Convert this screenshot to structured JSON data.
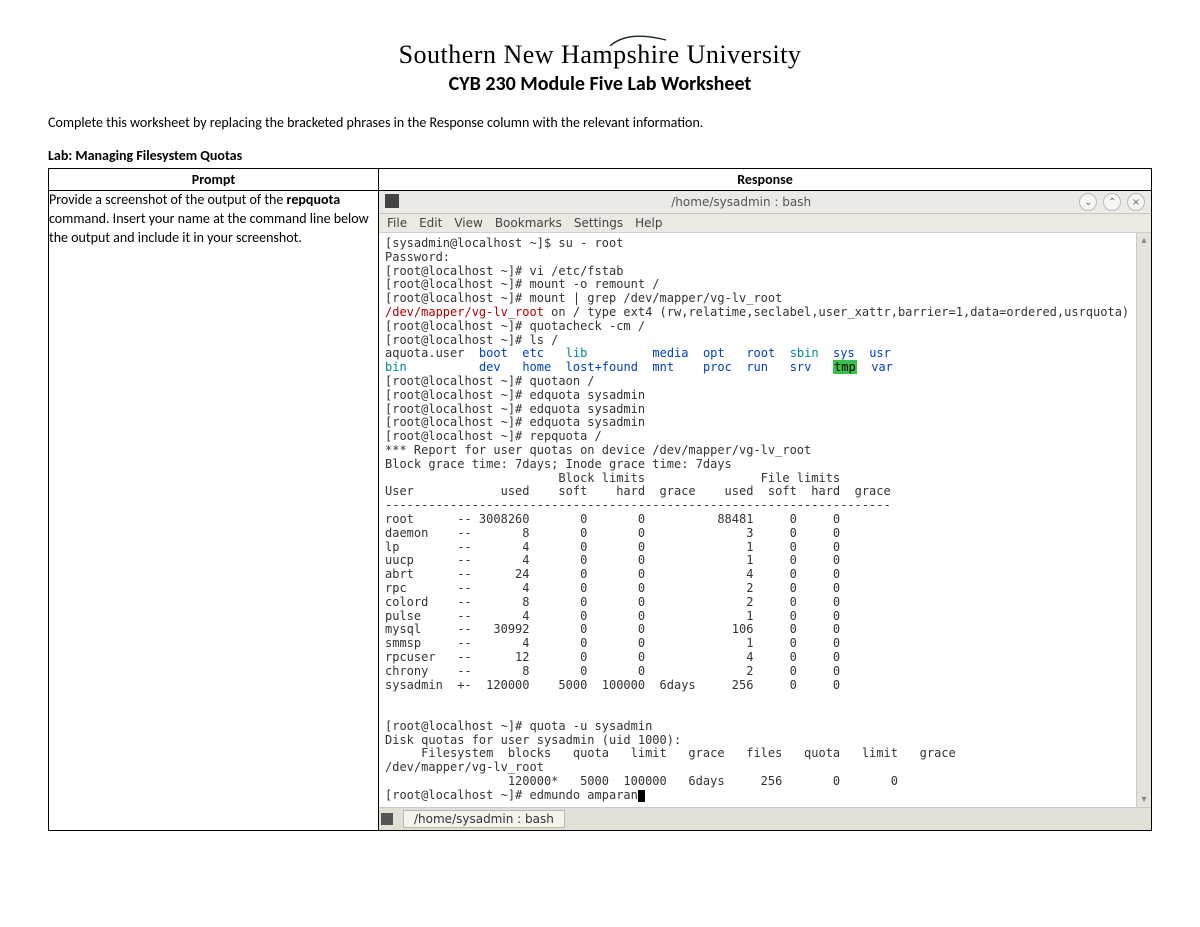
{
  "header": {
    "university": "Southern New Hampshire University",
    "course_title": "CYB 230 Module Five Lab Worksheet"
  },
  "instruction": "Complete this worksheet by replacing the bracketed phrases in the Response column with the relevant information.",
  "lab_section": "Lab: Managing Filesystem Quotas",
  "table": {
    "headers": {
      "prompt": "Prompt",
      "response": "Response"
    },
    "prompt_html": "Provide a screenshot of the output of the <b>repquota</b> command. Insert your name at the command line below the output and include it in your screenshot."
  },
  "window": {
    "title": "/home/sysadmin : bash",
    "menu": [
      "File",
      "Edit",
      "View",
      "Bookmarks",
      "Settings",
      "Help"
    ],
    "taskbar_tab": "/home/sysadmin : bash"
  },
  "terminal": {
    "lines": [
      {
        "segs": [
          {
            "t": "[sysadmin@localhost ~]$ su - root"
          }
        ]
      },
      {
        "segs": [
          {
            "t": "Password:"
          }
        ]
      },
      {
        "segs": [
          {
            "t": "[root@localhost ~]# vi /etc/fstab"
          }
        ]
      },
      {
        "segs": [
          {
            "t": "[root@localhost ~]# mount -o remount /"
          }
        ]
      },
      {
        "segs": [
          {
            "t": "[root@localhost ~]# mount | grep /dev/mapper/vg-lv_root"
          }
        ]
      },
      {
        "segs": [
          {
            "t": "/dev/mapper/vg-lv_root",
            "c": "t-red"
          },
          {
            "t": " on / type ext4 (rw,relatime,seclabel,user_xattr,barrier=1,data=ordered,usrquota)"
          }
        ]
      },
      {
        "segs": [
          {
            "t": "[root@localhost ~]# quotacheck -cm /"
          }
        ]
      },
      {
        "segs": [
          {
            "t": "[root@localhost ~]# ls /"
          }
        ]
      },
      {
        "segs": [
          {
            "t": "aquota.user  "
          },
          {
            "t": "boot",
            "c": "t-blue"
          },
          {
            "t": "  "
          },
          {
            "t": "etc",
            "c": "t-blue"
          },
          {
            "t": "   "
          },
          {
            "t": "lib",
            "c": "t-cyan"
          },
          {
            "t": "         "
          },
          {
            "t": "media",
            "c": "t-blue"
          },
          {
            "t": "  "
          },
          {
            "t": "opt",
            "c": "t-blue"
          },
          {
            "t": "   "
          },
          {
            "t": "root",
            "c": "t-blue"
          },
          {
            "t": "  "
          },
          {
            "t": "sbin",
            "c": "t-cyan"
          },
          {
            "t": "  "
          },
          {
            "t": "sys",
            "c": "t-blue"
          },
          {
            "t": "  "
          },
          {
            "t": "usr",
            "c": "t-blue"
          }
        ]
      },
      {
        "segs": [
          {
            "t": "bin",
            "c": "t-cyan"
          },
          {
            "t": "          "
          },
          {
            "t": "dev",
            "c": "t-blue"
          },
          {
            "t": "   "
          },
          {
            "t": "home",
            "c": "t-blue"
          },
          {
            "t": "  "
          },
          {
            "t": "lost+found",
            "c": "t-blue"
          },
          {
            "t": "  "
          },
          {
            "t": "mnt",
            "c": "t-blue"
          },
          {
            "t": "    "
          },
          {
            "t": "proc",
            "c": "t-blue"
          },
          {
            "t": "  "
          },
          {
            "t": "run",
            "c": "t-blue"
          },
          {
            "t": "   "
          },
          {
            "t": "srv",
            "c": "t-blue"
          },
          {
            "t": "   "
          },
          {
            "t": "tmp",
            "c": "t-hl"
          },
          {
            "t": "  "
          },
          {
            "t": "var",
            "c": "t-blue"
          }
        ]
      },
      {
        "segs": [
          {
            "t": "[root@localhost ~]# quotaon /"
          }
        ]
      },
      {
        "segs": [
          {
            "t": "[root@localhost ~]# edquota sysadmin"
          }
        ]
      },
      {
        "segs": [
          {
            "t": "[root@localhost ~]# edquota sysadmin"
          }
        ]
      },
      {
        "segs": [
          {
            "t": "[root@localhost ~]# edquota sysadmin"
          }
        ]
      },
      {
        "segs": [
          {
            "t": "[root@localhost ~]# repquota /"
          }
        ]
      },
      {
        "segs": [
          {
            "t": "*** Report for user quotas on device /dev/mapper/vg-lv_root"
          }
        ]
      },
      {
        "segs": [
          {
            "t": "Block grace time: 7days; Inode grace time: 7days"
          }
        ]
      },
      {
        "segs": [
          {
            "t": "                        Block limits                File limits"
          }
        ]
      },
      {
        "segs": [
          {
            "t": "User            used    soft    hard  grace    used  soft  hard  grace"
          }
        ]
      },
      {
        "segs": [
          {
            "t": "----------------------------------------------------------------------"
          }
        ]
      },
      {
        "segs": [
          {
            "t": "root      -- 3008260       0       0          88481     0     0"
          }
        ]
      },
      {
        "segs": [
          {
            "t": "daemon    --       8       0       0              3     0     0"
          }
        ]
      },
      {
        "segs": [
          {
            "t": "lp        --       4       0       0              1     0     0"
          }
        ]
      },
      {
        "segs": [
          {
            "t": "uucp      --       4       0       0              1     0     0"
          }
        ]
      },
      {
        "segs": [
          {
            "t": "abrt      --      24       0       0              4     0     0"
          }
        ]
      },
      {
        "segs": [
          {
            "t": "rpc       --       4       0       0              2     0     0"
          }
        ]
      },
      {
        "segs": [
          {
            "t": "colord    --       8       0       0              2     0     0"
          }
        ]
      },
      {
        "segs": [
          {
            "t": "pulse     --       4       0       0              1     0     0"
          }
        ]
      },
      {
        "segs": [
          {
            "t": "mysql     --   30992       0       0            106     0     0"
          }
        ]
      },
      {
        "segs": [
          {
            "t": "smmsp     --       4       0       0              1     0     0"
          }
        ]
      },
      {
        "segs": [
          {
            "t": "rpcuser   --      12       0       0              4     0     0"
          }
        ]
      },
      {
        "segs": [
          {
            "t": "chrony    --       8       0       0              2     0     0"
          }
        ]
      },
      {
        "segs": [
          {
            "t": "sysadmin  +-  120000    5000  100000  6days     256     0     0"
          }
        ]
      },
      {
        "segs": [
          {
            "t": ""
          }
        ]
      },
      {
        "segs": [
          {
            "t": ""
          }
        ]
      },
      {
        "segs": [
          {
            "t": "[root@localhost ~]# quota -u sysadmin"
          }
        ]
      },
      {
        "segs": [
          {
            "t": "Disk quotas for user sysadmin (uid 1000):"
          }
        ]
      },
      {
        "segs": [
          {
            "t": "     Filesystem  blocks   quota   limit   grace   files   quota   limit   grace"
          }
        ]
      },
      {
        "segs": [
          {
            "t": "/dev/mapper/vg-lv_root"
          }
        ]
      },
      {
        "segs": [
          {
            "t": "                 120000*   5000  100000   6days     256       0       0"
          }
        ]
      },
      {
        "segs": [
          {
            "t": "[root@localhost ~]# edmundo amparan"
          },
          {
            "t": "",
            "cursor": true
          }
        ]
      }
    ]
  }
}
